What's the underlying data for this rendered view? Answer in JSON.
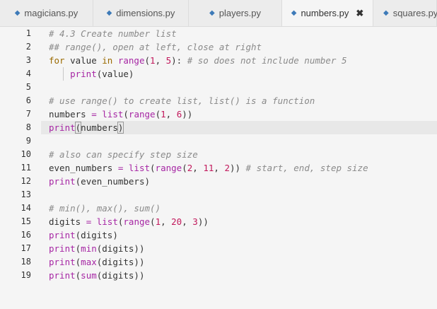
{
  "tabs": [
    {
      "label": "magicians.py",
      "active": false
    },
    {
      "label": "dimensions.py",
      "active": false
    },
    {
      "label": "players.py",
      "active": false
    },
    {
      "label": "numbers.py",
      "active": true
    },
    {
      "label": "squares.py",
      "active": false
    }
  ],
  "close_glyph": "✖",
  "line_numbers": [
    "1",
    "2",
    "3",
    "4",
    "5",
    "6",
    "7",
    "8",
    "9",
    "10",
    "11",
    "12",
    "13",
    "14",
    "15",
    "16",
    "17",
    "18",
    "19"
  ],
  "code": {
    "l1": {
      "c": "# 4.3 Create number list"
    },
    "l2": {
      "c": "## range(), open at left, close at right"
    },
    "l3": {
      "kw": "for",
      "v": " value ",
      "kw2": "in",
      "sp": " ",
      "fn": "range",
      "o": "(",
      "n1": "1",
      "cm": ", ",
      "n2": "5",
      "cl": "): ",
      "c": "# so does not include number 5"
    },
    "l4": {
      "fn": "print",
      "rest": "(value)"
    },
    "l6": {
      "c": "# use range() to create list, list() is a function"
    },
    "l7": {
      "v": "numbers ",
      "op": "=",
      "sp": " ",
      "fn": "list",
      "o": "(",
      "fn2": "range",
      "o2": "(",
      "n1": "1",
      "cm": ", ",
      "n2": "6",
      "cl": "))"
    },
    "l8": {
      "fn": "print",
      "o": "(",
      "v": "numbers",
      "cl": ")"
    },
    "l10": {
      "c": "# also can specify step size"
    },
    "l11": {
      "v": "even_numbers ",
      "op": "=",
      "sp": " ",
      "fn": "list",
      "o": "(",
      "fn2": "range",
      "o2": "(",
      "n1": "2",
      "cm": ", ",
      "n2": "11",
      "cm2": ", ",
      "n3": "2",
      "cl": ")) ",
      "c": "# start, end, step size"
    },
    "l12": {
      "fn": "print",
      "rest": "(even_numbers)"
    },
    "l14": {
      "c": "# min(), max(), sum()"
    },
    "l15": {
      "v": "digits ",
      "op": "=",
      "sp": " ",
      "fn": "list",
      "o": "(",
      "fn2": "range",
      "o2": "(",
      "n1": "1",
      "cm": ", ",
      "n2": "20",
      "cm2": ", ",
      "n3": "3",
      "cl": "))"
    },
    "l16": {
      "fn": "print",
      "rest": "(digits)"
    },
    "l17": {
      "fn": "print",
      "o": "(",
      "fn2": "min",
      "rest": "(digits))"
    },
    "l18": {
      "fn": "print",
      "o": "(",
      "fn2": "max",
      "rest": "(digits))"
    },
    "l19": {
      "fn": "print",
      "o": "(",
      "fn2": "sum",
      "rest": "(digits))"
    }
  },
  "colors": {
    "keyword": "#9a6a00",
    "function": "#a626a4",
    "number": "#c2185b",
    "comment": "#8a8a8a",
    "icon": "#3d7ab8"
  },
  "icons": {
    "tab_file": "python-file-icon",
    "close": "close-icon"
  }
}
